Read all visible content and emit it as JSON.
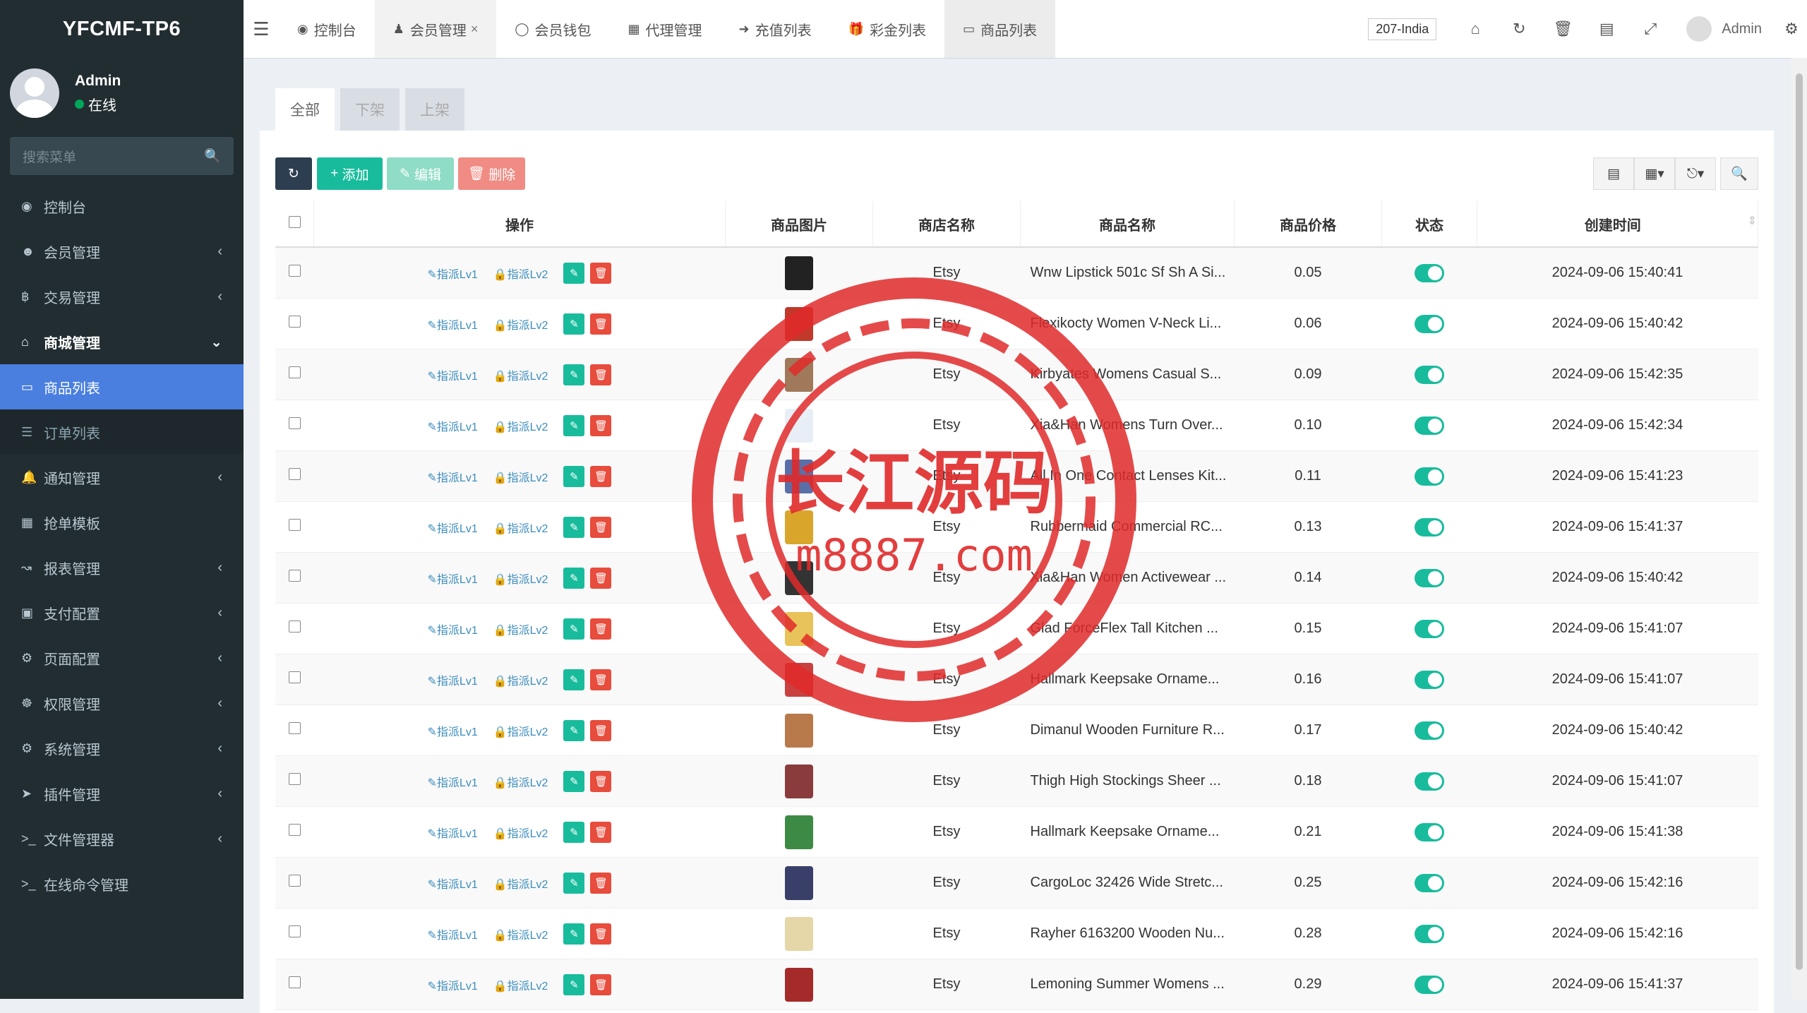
{
  "brand": "YFCMF-TP6",
  "user": {
    "name": "Admin",
    "status": "在线"
  },
  "sidebar": {
    "search_placeholder": "搜索菜单",
    "items": [
      {
        "label": "控制台",
        "icon": "dashboard-icon",
        "arrow": false
      },
      {
        "label": "会员管理",
        "icon": "user-circle-icon",
        "arrow": true
      },
      {
        "label": "交易管理",
        "icon": "bitcoin-icon",
        "arrow": true
      },
      {
        "label": "商城管理",
        "icon": "home-icon",
        "arrow": true,
        "open": true
      },
      {
        "label": "商品列表",
        "icon": "desktop-icon",
        "active": true
      },
      {
        "label": "订单列表",
        "icon": "list-icon",
        "sub": true
      },
      {
        "label": "通知管理",
        "icon": "bell-icon",
        "arrow": true
      },
      {
        "label": "抢单模板",
        "icon": "sitemap-icon",
        "arrow": false
      },
      {
        "label": "报表管理",
        "icon": "chart-icon",
        "arrow": true
      },
      {
        "label": "支付配置",
        "icon": "credit-card-icon",
        "arrow": true
      },
      {
        "label": "页面配置",
        "icon": "gear-icon",
        "arrow": true
      },
      {
        "label": "权限管理",
        "icon": "group-icon",
        "arrow": true
      },
      {
        "label": "系统管理",
        "icon": "cogs-icon",
        "arrow": true
      },
      {
        "label": "插件管理",
        "icon": "rocket-icon",
        "arrow": true
      },
      {
        "label": "文件管理器",
        "icon": "terminal-icon",
        "arrow": true
      },
      {
        "label": "在线命令管理",
        "icon": "terminal-icon",
        "arrow": false
      }
    ]
  },
  "header": {
    "tabs": [
      {
        "label": "控制台",
        "icon": "dashboard-icon"
      },
      {
        "label": "会员管理",
        "icon": "user-icon",
        "closable": true
      },
      {
        "label": "会员钱包",
        "icon": "wallet-icon"
      },
      {
        "label": "代理管理",
        "icon": "sitemap-icon"
      },
      {
        "label": "充值列表",
        "icon": "sign-in-icon"
      },
      {
        "label": "彩金列表",
        "icon": "gift-icon"
      },
      {
        "label": "商品列表",
        "icon": "desktop-icon",
        "current": true
      }
    ],
    "country": "207-India",
    "admin": "Admin"
  },
  "filters": [
    "全部",
    "下架",
    "上架"
  ],
  "toolbar": {
    "add": "添加",
    "edit": "编辑",
    "delete": "删除"
  },
  "columns": [
    "操作",
    "商品图片",
    "商店名称",
    "商品名称",
    "商品价格",
    "状态",
    "创建时间"
  ],
  "ops": {
    "lv1": "指派Lv1",
    "lv2": "指派Lv2"
  },
  "rows": [
    {
      "shop": "Etsy",
      "name": "Wnw Lipstick 501c Sf Sh A Si...",
      "price": "0.05",
      "time": "2024-09-06 15:40:41",
      "color": "#222"
    },
    {
      "shop": "Etsy",
      "name": "Flexikocty Women V-Neck Li...",
      "price": "0.06",
      "time": "2024-09-06 15:40:42",
      "color": "#c0392b"
    },
    {
      "shop": "Etsy",
      "name": "Kirbyates Womens Casual S...",
      "price": "0.09",
      "time": "2024-09-06 15:42:35",
      "color": "#a0785a"
    },
    {
      "shop": "Etsy",
      "name": "Xia&Han Womens Turn Over...",
      "price": "0.10",
      "time": "2024-09-06 15:42:34",
      "color": "#e8eef5"
    },
    {
      "shop": "Etsy",
      "name": "All In One Contact Lenses Kit...",
      "price": "0.11",
      "time": "2024-09-06 15:41:23",
      "color": "#5a6fa8"
    },
    {
      "shop": "Etsy",
      "name": "Rubbermaid Commercial RC...",
      "price": "0.13",
      "time": "2024-09-06 15:41:37",
      "color": "#d9a52b"
    },
    {
      "shop": "Etsy",
      "name": "Xia&Han Women Activewear ...",
      "price": "0.14",
      "time": "2024-09-06 15:40:42",
      "color": "#333"
    },
    {
      "shop": "Etsy",
      "name": "Glad ForceFlex Tall Kitchen ...",
      "price": "0.15",
      "time": "2024-09-06 15:41:07",
      "color": "#e8c35a"
    },
    {
      "shop": "Etsy",
      "name": "Hallmark Keepsake Orname...",
      "price": "0.16",
      "time": "2024-09-06 15:41:07",
      "color": "#c94040"
    },
    {
      "shop": "Etsy",
      "name": "Dimanul Wooden Furniture R...",
      "price": "0.17",
      "time": "2024-09-06 15:40:42",
      "color": "#b87a4a"
    },
    {
      "shop": "Etsy",
      "name": "Thigh High Stockings Sheer ...",
      "price": "0.18",
      "time": "2024-09-06 15:41:07",
      "color": "#8a3b3b"
    },
    {
      "shop": "Etsy",
      "name": "Hallmark Keepsake Orname...",
      "price": "0.21",
      "time": "2024-09-06 15:41:38",
      "color": "#3d8a45"
    },
    {
      "shop": "Etsy",
      "name": "CargoLoc 32426 Wide Stretc...",
      "price": "0.25",
      "time": "2024-09-06 15:42:16",
      "color": "#3a3f6a"
    },
    {
      "shop": "Etsy",
      "name": "Rayher 6163200 Wooden Nu...",
      "price": "0.28",
      "time": "2024-09-06 15:42:16",
      "color": "#e6d7a8"
    },
    {
      "shop": "Etsy",
      "name": "Lemoning Summer Womens ...",
      "price": "0.29",
      "time": "2024-09-06 15:41:37",
      "color": "#a52a2a"
    }
  ],
  "watermark": {
    "title": "长江源码",
    "url": "m8887.com"
  }
}
